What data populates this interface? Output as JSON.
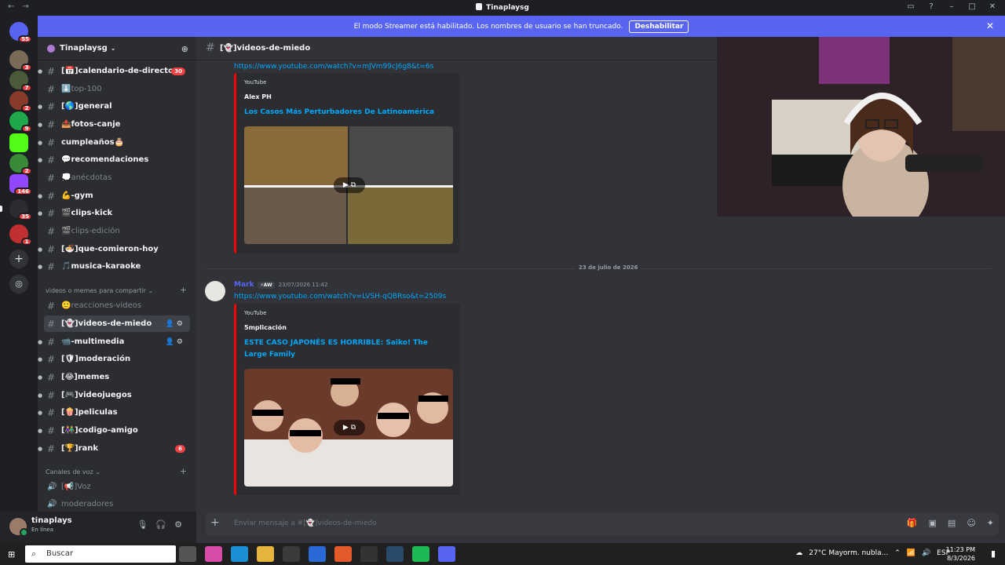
{
  "window": {
    "title": "Tinaplaysg"
  },
  "streamer_banner": {
    "text": "El modo Streamer está habilitado. Los nombres de usuario se han truncado.",
    "button": "Deshabilitar"
  },
  "server_rail": {
    "badges": [
      "55",
      "3",
      "7",
      "2",
      "9",
      "2",
      "1",
      "146",
      "35",
      "1"
    ]
  },
  "guild": {
    "name": "Tinaplaysg",
    "chevron": "⌄"
  },
  "channels_top": [
    {
      "name": "[📅]calendario-de-directo",
      "unread": true,
      "count": "30"
    },
    {
      "name": "⬇️top-100",
      "unread": false,
      "count": ""
    },
    {
      "name": "[🌎]general",
      "unread": true,
      "count": ""
    },
    {
      "name": "📤fotos-canje",
      "unread": true,
      "count": ""
    },
    {
      "name": "cumpleaños🎂",
      "unread": true,
      "count": ""
    },
    {
      "name": "💬recomendaciones",
      "unread": true,
      "count": ""
    },
    {
      "name": "💭anécdotas",
      "unread": false,
      "count": ""
    },
    {
      "name": "💪-gym",
      "unread": true,
      "count": ""
    },
    {
      "name": "🎬clips-kick",
      "unread": true,
      "count": ""
    },
    {
      "name": "🎬clips-edición",
      "unread": false,
      "count": ""
    },
    {
      "name": "[🍜]que-comieron-hoy",
      "unread": true,
      "count": ""
    },
    {
      "name": "🎵musica-karaoke",
      "unread": true,
      "count": ""
    }
  ],
  "category_videos": {
    "name": "videos o memes para compartir",
    "plus": "+"
  },
  "channels_videos": [
    {
      "name": "🙂reacciones-videos",
      "unread": false,
      "count": "",
      "selected": false
    },
    {
      "name": "[👻]videos-de-miedo",
      "unread": true,
      "count": "",
      "selected": true
    },
    {
      "name": "📹-multimedia",
      "unread": true,
      "count": "",
      "selected": false
    },
    {
      "name": "[🛡]moderación",
      "unread": true,
      "count": "",
      "selected": false
    },
    {
      "name": "[😂]memes",
      "unread": true,
      "count": "",
      "selected": false
    },
    {
      "name": "[🎮]videojuegos",
      "unread": true,
      "count": "",
      "selected": false
    },
    {
      "name": "[🍿]peliculas",
      "unread": true,
      "count": "",
      "selected": false
    },
    {
      "name": "[👫]codigo-amigo",
      "unread": true,
      "count": "",
      "selected": false
    },
    {
      "name": "[🏆]rank",
      "unread": true,
      "count": "6",
      "selected": false
    }
  ],
  "category_voice": {
    "name": "Canales de voz",
    "plus": "+"
  },
  "voice_channels": [
    {
      "name": "[📢]Voz"
    },
    {
      "name": "moderadores"
    }
  ],
  "user": {
    "name": "tinaplays",
    "status": "En línea"
  },
  "chat": {
    "channel_name": "[👻]videos-de-miedo",
    "msg1": {
      "link": "https://www.youtube.com/watch?v=mJVm99cJ6g8&t=6s",
      "provider": "YouTube",
      "author": "Alex PH",
      "title": "Los Casos Más Perturbadores De Latinoamérica"
    },
    "date_divider": "23 de julio de 2026",
    "msg2": {
      "author": "Mark",
      "tag": "⚡AW",
      "timestamp": "23/07/2026 11:42",
      "link": "https://www.youtube.com/watch?v=LVSH-qQBRso&t=2509s",
      "provider": "YouTube",
      "embed_author": "5mplicación",
      "title": "ESTE CASO JAPONÉS ES HORRIBLE: Saiko! The Large Family"
    },
    "composer_placeholder": "Enviar mensaje a #[👻]videos-de-miedo"
  },
  "taskbar": {
    "search": "Buscar",
    "weather": "27°C  Mayorm. nubla...",
    "lang": "ESP",
    "time": "11:23 PM",
    "date": "8/3/2026"
  },
  "colors": {
    "accent": "#5865f2",
    "danger": "#f23f43",
    "link": "#00a8fc",
    "online": "#23a55a"
  }
}
